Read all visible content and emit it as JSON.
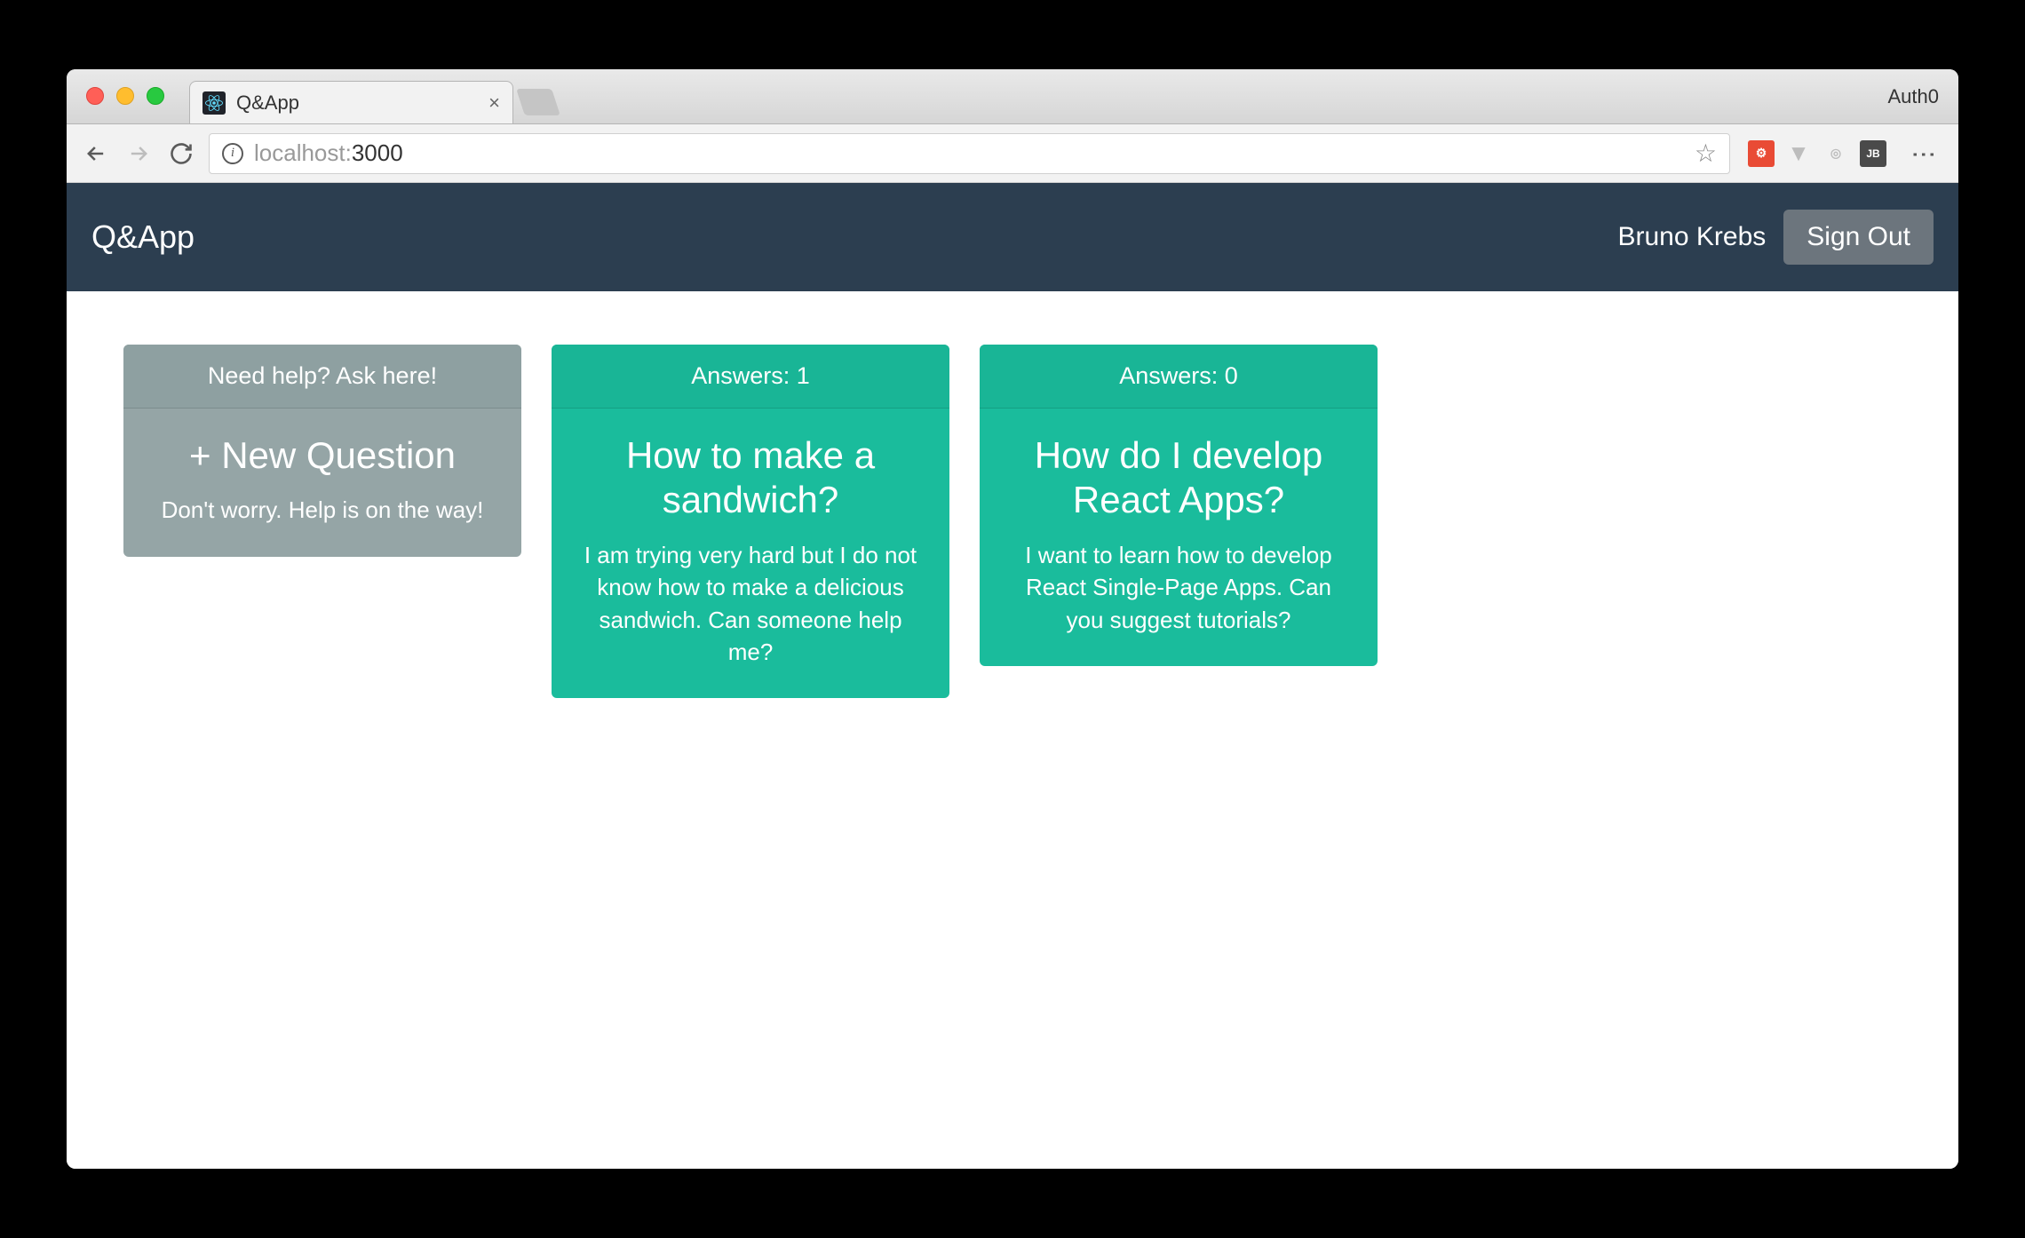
{
  "browser": {
    "tab_title": "Q&App",
    "url_host": "localhost:",
    "url_port": "3000",
    "profile": "Auth0"
  },
  "app": {
    "brand": "Q&App",
    "user": "Bruno Krebs",
    "sign_out": "Sign Out"
  },
  "new_card": {
    "header": "Need help? Ask here!",
    "title": "+ New Question",
    "text": "Don't worry. Help is on the way!"
  },
  "questions": [
    {
      "answers_label": "Answers: 1",
      "title": "How to make a sandwich?",
      "text": "I am trying very hard but I do not know how to make a delicious sandwich. Can someone help me?"
    },
    {
      "answers_label": "Answers: 0",
      "title": "How do I develop React Apps?",
      "text": "I want to learn how to develop React Single-Page Apps. Can you suggest tutorials?"
    }
  ]
}
